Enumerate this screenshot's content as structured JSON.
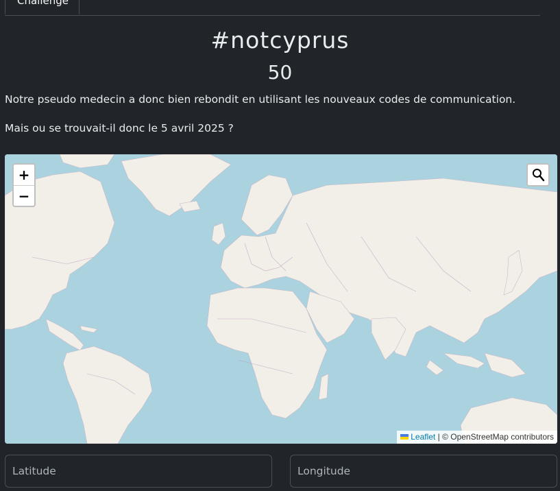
{
  "tabs": [
    {
      "label": "Challenge"
    }
  ],
  "challenge": {
    "title": "#notcyprus",
    "points": "50",
    "description_1": "Notre pseudo medecin a donc bien rebondit en utilisant les nouveaux codes de communication.",
    "description_2": "Mais ou se trouvait-il donc le 5 avril 2025 ?"
  },
  "map": {
    "zoom_in_label": "+",
    "zoom_out_label": "−",
    "attribution": {
      "leaflet_label": "Leaflet",
      "separator": "|",
      "copyright": "© OpenStreetMap contributors"
    },
    "colors": {
      "water": "#aad3df",
      "land": "#f2efe9",
      "border": "#b99ac2"
    }
  },
  "form": {
    "latitude_placeholder": "Latitude",
    "longitude_placeholder": "Longitude"
  }
}
